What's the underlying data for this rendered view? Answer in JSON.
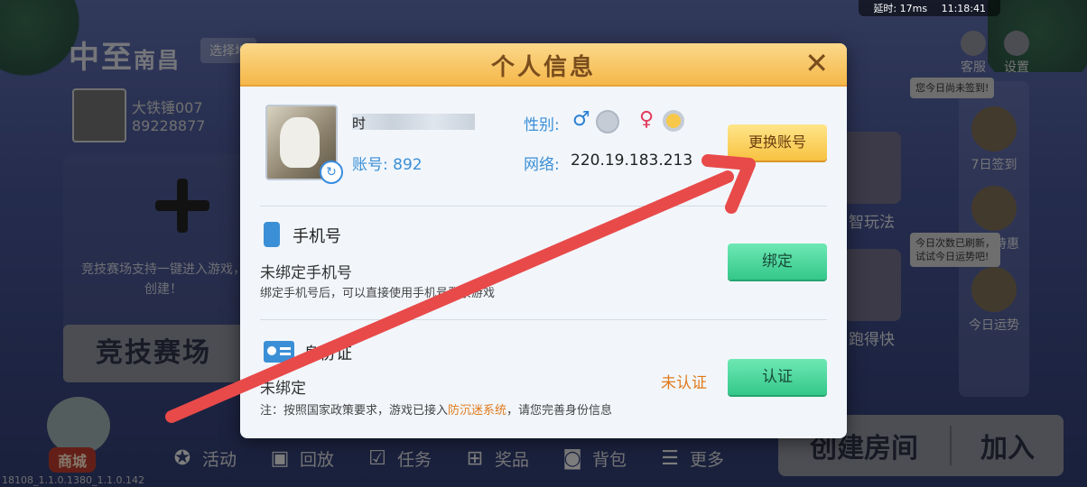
{
  "status": {
    "latency": "延时: 17ms",
    "time": "11:18:41"
  },
  "lobby": {
    "logo_main": "中至",
    "logo_sub": "南昌",
    "select_location": "选择地",
    "profile_name": "大铁锤007",
    "profile_id": "89228877",
    "arena_desc": "竞技赛场支持一键进入游戏，创建！",
    "arena_button": "竞技赛场",
    "shop_label": "商城",
    "version": "18108_1.1.0.1380_1.1.0.142",
    "nav": [
      {
        "label": "活动",
        "icon": "star-badge-icon"
      },
      {
        "label": "回放",
        "icon": "tv-icon"
      },
      {
        "label": "任务",
        "icon": "checklist-icon"
      },
      {
        "label": "奖品",
        "icon": "gift-icon"
      },
      {
        "label": "背包",
        "icon": "backpack-icon"
      },
      {
        "label": "更多",
        "icon": "menu-icon"
      }
    ],
    "create_room": "创建房间",
    "join": "加入",
    "top_right": [
      {
        "label": "客服"
      },
      {
        "label": "设置"
      }
    ],
    "sign_tip": "您今日尚未签到!",
    "fortune_tip": "今日次数已刷新，试试今日运势吧!",
    "right_items": [
      {
        "label": "7日签到"
      },
      {
        "label": "记牌特惠"
      },
      {
        "label": "今日运势"
      }
    ],
    "mid_games": [
      {
        "label": "智玩法"
      },
      {
        "label": "跑得快"
      }
    ]
  },
  "dialog": {
    "title": "个人信息",
    "close_glyph": "✕",
    "name_masked": "时",
    "account_label": "账号: 892",
    "gender_label": "性别:",
    "gender_male": "♂",
    "gender_female": "♀",
    "gender_selected": "female",
    "network_label": "网络:",
    "network_value": "220.19.183.213",
    "switch_account": "更换账号",
    "phone": {
      "title": "手机号",
      "status": "未绑定手机号",
      "note": "绑定手机号后，可以直接使用手机号登录游戏",
      "button": "绑定"
    },
    "id": {
      "title": "身份证",
      "status": "未绑定",
      "verify_state": "未认证",
      "button": "认证",
      "note_prefix": "注：按照国家政策要求，游戏已接入",
      "note_link": "防沉迷系统",
      "note_suffix": "，请您完善身份信息"
    }
  },
  "colors": {
    "header_gold": "#f5b84a",
    "accent_blue": "#3b8fd6",
    "green_button": "#34c88a",
    "orange_warn": "#e07a1c",
    "arrow_red": "#e84a4a"
  }
}
